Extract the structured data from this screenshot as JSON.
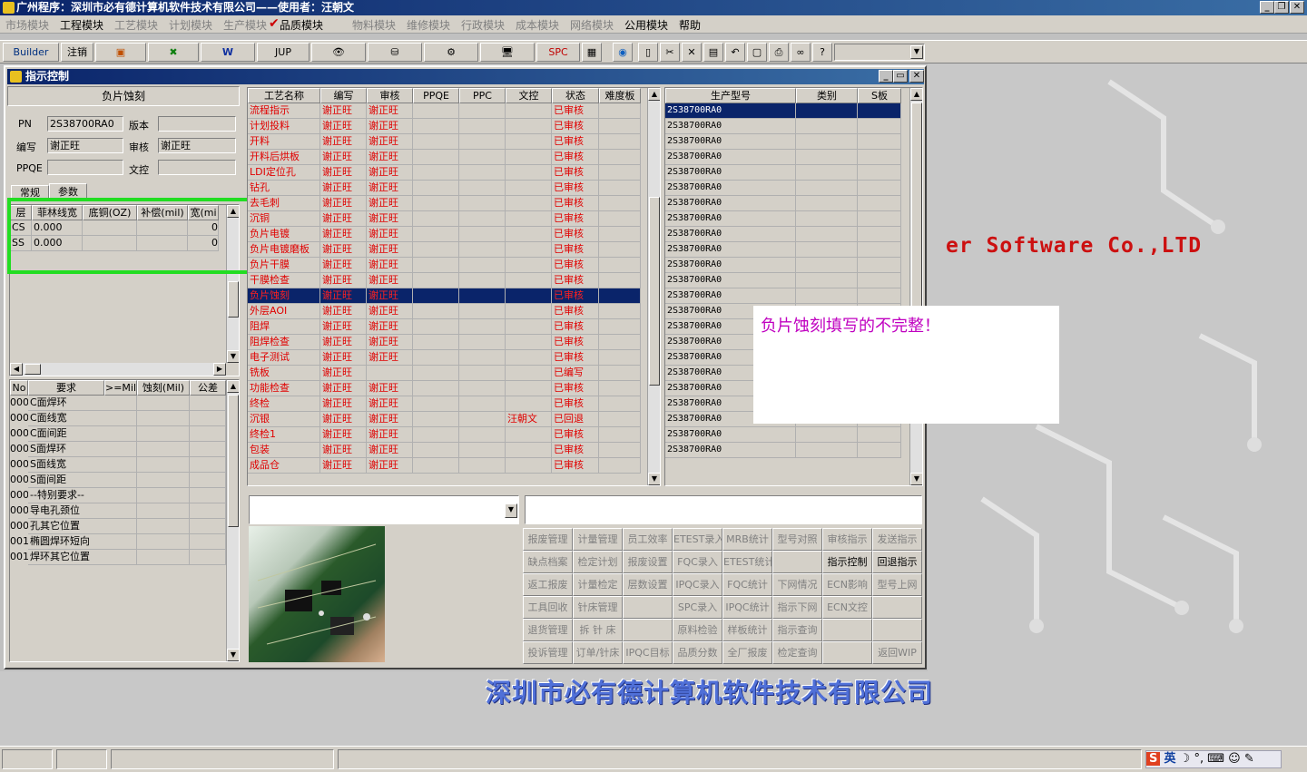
{
  "app": {
    "title": "广州程序：深圳市必有德计算机软件技术有限公司——使用者：汪朝文"
  },
  "menu": [
    "市场模块",
    "工程模块",
    "工艺模块",
    "计划模块",
    "生产模块",
    "品质模块",
    "物料模块",
    "维修模块",
    "行政模块",
    "成本模块",
    "网络模块",
    "公用模块",
    "帮助"
  ],
  "menu_active": [
    1,
    5,
    11,
    12
  ],
  "toolbar": {
    "builder": "Builder",
    "logout": "注销",
    "jup": "JUP",
    "spc": "SPC"
  },
  "window": {
    "title": "指示控制"
  },
  "left": {
    "section_title": "负片蚀刻",
    "pn_label": "PN",
    "pn_value": "2S38700RA0",
    "version_label": "版本",
    "version_value": "",
    "author_label": "编写",
    "author_value": "谢正旺",
    "review_label": "审核",
    "review_value": "谢正旺",
    "ppqe_label": "PPQE",
    "ppqe_value": "",
    "doc_label": "文控",
    "doc_value": "",
    "tabs": [
      "常规",
      "参数"
    ],
    "param_headers": [
      "层",
      "菲林线宽",
      "底铜(OZ)",
      "补偿(mil)",
      "宽(mi"
    ],
    "param_rows": [
      [
        "CS",
        "0.000",
        "",
        "",
        "0"
      ],
      [
        "SS",
        "0.000",
        "",
        "",
        "0"
      ]
    ],
    "req_headers": [
      "No",
      "要求",
      ">=Mil",
      "蚀刻(Mil)",
      "公差"
    ],
    "req_rows": [
      [
        "000",
        "C面焊环"
      ],
      [
        "000",
        "C面线宽"
      ],
      [
        "000",
        "C面间距"
      ],
      [
        "000",
        "S面焊环"
      ],
      [
        "000",
        "S面线宽"
      ],
      [
        "000",
        "S面间距"
      ],
      [
        "000",
        "--特别要求--"
      ],
      [
        "000",
        "导电孔颈位"
      ],
      [
        "000",
        "孔其它位置"
      ],
      [
        "001",
        "椭圆焊环短向"
      ],
      [
        "001",
        "焊环其它位置"
      ]
    ]
  },
  "process": {
    "headers": [
      "工艺名称",
      "编写",
      "审核",
      "PPQE",
      "PPC",
      "文控",
      "状态",
      "难度板"
    ],
    "rows": [
      [
        "流程指示",
        "谢正旺",
        "谢正旺",
        "",
        "",
        "",
        "已审核"
      ],
      [
        "计划投料",
        "谢正旺",
        "谢正旺",
        "",
        "",
        "",
        "已审核"
      ],
      [
        "开料",
        "谢正旺",
        "谢正旺",
        "",
        "",
        "",
        "已审核"
      ],
      [
        "开料后烘板",
        "谢正旺",
        "谢正旺",
        "",
        "",
        "",
        "已审核"
      ],
      [
        "LDI定位孔",
        "谢正旺",
        "谢正旺",
        "",
        "",
        "",
        "已审核"
      ],
      [
        "钻孔",
        "谢正旺",
        "谢正旺",
        "",
        "",
        "",
        "已审核"
      ],
      [
        "去毛刺",
        "谢正旺",
        "谢正旺",
        "",
        "",
        "",
        "已审核"
      ],
      [
        "沉铜",
        "谢正旺",
        "谢正旺",
        "",
        "",
        "",
        "已审核"
      ],
      [
        "负片电镀",
        "谢正旺",
        "谢正旺",
        "",
        "",
        "",
        "已审核"
      ],
      [
        "负片电镀磨板",
        "谢正旺",
        "谢正旺",
        "",
        "",
        "",
        "已审核"
      ],
      [
        "负片干膜",
        "谢正旺",
        "谢正旺",
        "",
        "",
        "",
        "已审核"
      ],
      [
        "干膜检查",
        "谢正旺",
        "谢正旺",
        "",
        "",
        "",
        "已审核"
      ],
      [
        "负片蚀刻",
        "谢正旺",
        "谢正旺",
        "",
        "",
        "",
        "已审核"
      ],
      [
        "外层AOI",
        "谢正旺",
        "谢正旺",
        "",
        "",
        "",
        "已审核"
      ],
      [
        "阻焊",
        "谢正旺",
        "谢正旺",
        "",
        "",
        "",
        "已审核"
      ],
      [
        "阻焊检查",
        "谢正旺",
        "谢正旺",
        "",
        "",
        "",
        "已审核"
      ],
      [
        "电子测试",
        "谢正旺",
        "谢正旺",
        "",
        "",
        "",
        "已审核"
      ],
      [
        "铣板",
        "谢正旺",
        "",
        "",
        "",
        "",
        "已编写"
      ],
      [
        "功能检查",
        "谢正旺",
        "谢正旺",
        "",
        "",
        "",
        "已审核"
      ],
      [
        "终检",
        "谢正旺",
        "谢正旺",
        "",
        "",
        "",
        "已审核"
      ],
      [
        "沉银",
        "谢正旺",
        "谢正旺",
        "",
        "",
        "汪朝文",
        "已回退"
      ],
      [
        "终检1",
        "谢正旺",
        "谢正旺",
        "",
        "",
        "",
        "已审核"
      ],
      [
        "包装",
        "谢正旺",
        "谢正旺",
        "",
        "",
        "",
        "已审核"
      ],
      [
        "成品仓",
        "谢正旺",
        "谢正旺",
        "",
        "",
        "",
        "已审核"
      ]
    ],
    "selected_index": 12
  },
  "models": {
    "headers": [
      "生产型号",
      "类别",
      "S板"
    ],
    "rows": [
      "2S38700RA0",
      "2S38700RA0",
      "2S38700RA0",
      "2S38700RA0",
      "2S38700RA0",
      "2S38700RA0",
      "2S38700RA0",
      "2S38700RA0",
      "2S38700RA0",
      "2S38700RA0",
      "2S38700RA0",
      "2S38700RA0",
      "2S38700RA0",
      "2S38700RA0",
      "2S38700RA0",
      "2S38700RA0",
      "2S38700RA0",
      "2S38700RA0",
      "2S38700RA0",
      "2S38700RA0",
      "2S38700RA0",
      "2S38700RA0",
      "2S38700RA0"
    ],
    "selected_index": 0
  },
  "note": "负片蚀刻填写的不完整！",
  "buttons": [
    [
      "报废管理",
      "计量管理",
      "员工效率",
      "ETEST录入",
      "MRB统计",
      "型号对照",
      "审核指示",
      "发送指示"
    ],
    [
      "缺点档案",
      "检定计划",
      "报废设置",
      "FQC录入",
      "ETEST统计",
      "",
      "指示控制",
      "回退指示"
    ],
    [
      "返工报废",
      "计量检定",
      "层数设置",
      "IPQC录入",
      "FQC统计",
      "下网情况",
      "ECN影响",
      "型号上网"
    ],
    [
      "工具回收",
      "针床管理",
      "",
      "SPC录入",
      "IPQC统计",
      "指示下网",
      "ECN文控",
      ""
    ],
    [
      "退货管理",
      "拆 针 床",
      "",
      "原料检验",
      "样板统计",
      "指示查询",
      "",
      ""
    ],
    [
      "投诉管理",
      "订单/针床",
      "IPQC目标",
      "品质分数",
      "全厂报废",
      "检定查询",
      "",
      "返回WIP"
    ]
  ],
  "buttons_active": [
    "指示控制",
    "回退指示"
  ],
  "brand": {
    "company": "深圳市必有德计算机软件技术有限公司",
    "english": "er Software Co.,LTD"
  },
  "tray": {
    "ime": "英"
  },
  "colors": {
    "title": "#0a246a",
    "selected": "#0a246a",
    "status_red": "#e00000",
    "highlight_box": "#22dd22",
    "note_text": "#c000c0",
    "brand_blue": "#3050c0",
    "brand_red": "#cc1010"
  }
}
